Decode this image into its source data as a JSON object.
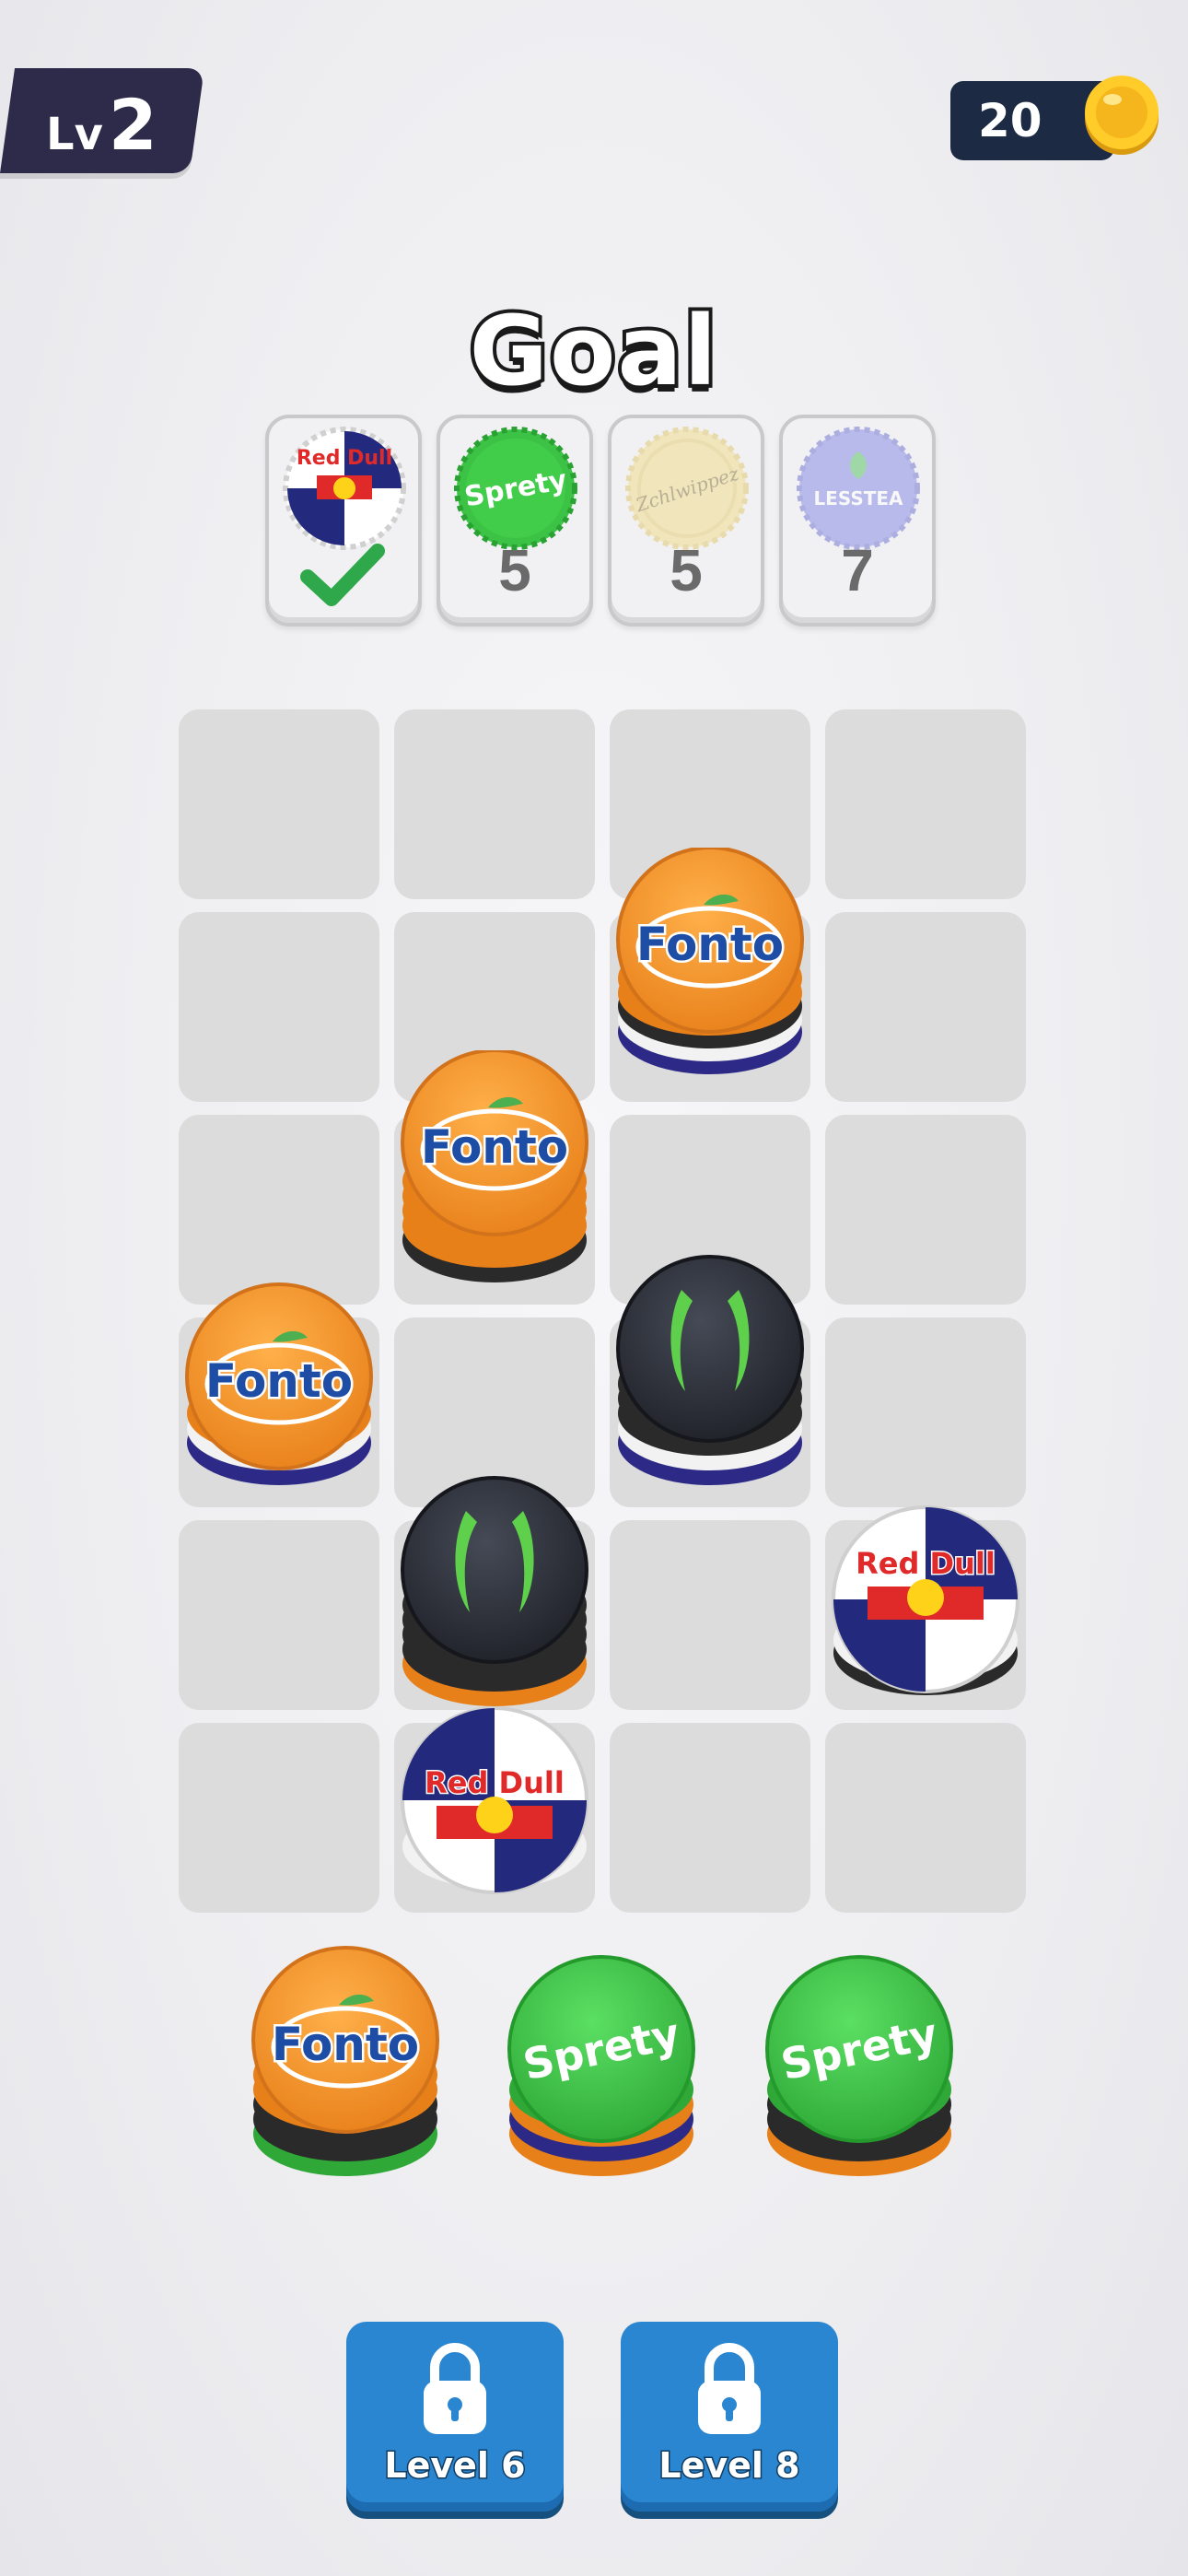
{
  "hud": {
    "level_prefix": "Lv",
    "level_number": "2",
    "coins": "20"
  },
  "goal": {
    "title": "Goal",
    "items": [
      {
        "brand": "Red Dull",
        "status": "done",
        "count": ""
      },
      {
        "brand": "Sprety",
        "status": "active",
        "count": "5"
      },
      {
        "brand": "Zchlwippez",
        "status": "locked",
        "count": "5"
      },
      {
        "brand": "LESSTEA",
        "status": "locked",
        "count": "7"
      }
    ]
  },
  "caps": {
    "fonto": "Fonto",
    "sprety": "Sprety",
    "reddull": "Red Dull"
  },
  "buttons": {
    "locked_slot_1": "Level 6",
    "locked_slot_2": "Level 8"
  },
  "colors": {
    "fonto": "#f39a2b",
    "sprety": "#3cc245",
    "monster": "#2b2e36",
    "reddull_blue": "#232a7e",
    "button_blue": "#2b86d1",
    "hud_dark": "#2e2a4a"
  }
}
